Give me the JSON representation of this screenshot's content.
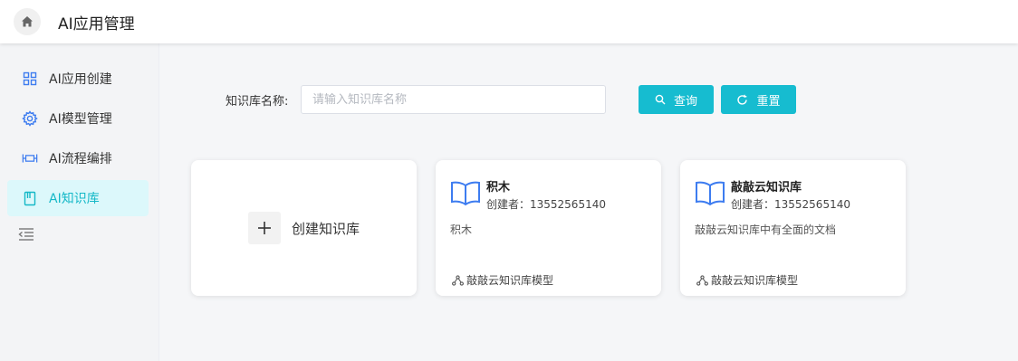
{
  "header": {
    "title": "AI应用管理",
    "home_icon": "home-icon"
  },
  "sidebar": {
    "items": [
      {
        "label": "AI应用创建",
        "icon": "grid-icon",
        "active": false
      },
      {
        "label": "AI模型管理",
        "icon": "gear-icon",
        "active": false
      },
      {
        "label": "AI流程编排",
        "icon": "flow-icon",
        "active": false
      },
      {
        "label": "AI知识库",
        "icon": "book-icon",
        "active": true
      }
    ],
    "collapse_icon": "collapse-menu-icon"
  },
  "search": {
    "label": "知识库名称:",
    "placeholder": "请输入知识库名称",
    "value": "",
    "query_label": "查询",
    "reset_label": "重置"
  },
  "create_card": {
    "label": "创建知识库"
  },
  "cards": [
    {
      "name": "积木",
      "creator": "创建者：13552565140",
      "description": "积木",
      "model": "敲敲云知识库模型"
    },
    {
      "name": "敲敲云知识库",
      "creator": "创建者：13552565140",
      "description": "敲敲云知识库中有全面的文档",
      "model": "敲敲云知识库模型"
    }
  ],
  "colors": {
    "accent": "#16bcd0",
    "active_bg": "#dcf8fb",
    "icon_blue": "#3d7cf0"
  }
}
